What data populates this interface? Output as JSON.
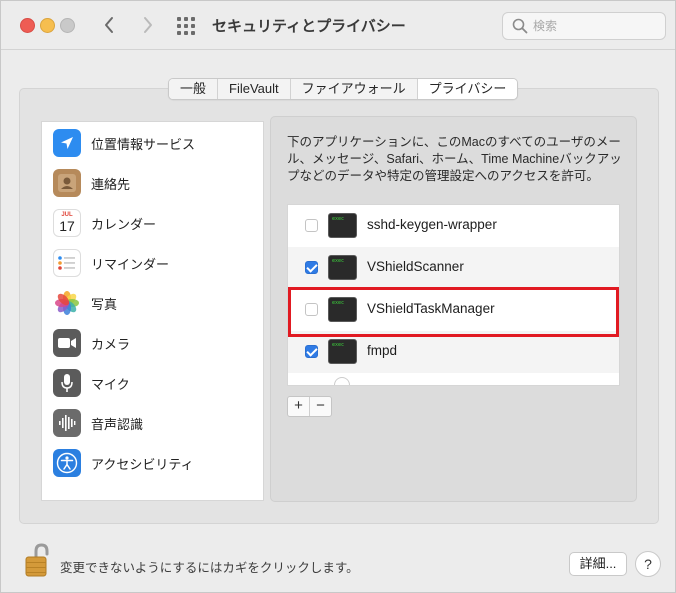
{
  "window": {
    "title": "セキュリティとプライバシー",
    "search_placeholder": "検索"
  },
  "tabs": [
    {
      "label": "一般",
      "active": false
    },
    {
      "label": "FileVault",
      "active": false
    },
    {
      "label": "ファイアウォール",
      "active": false
    },
    {
      "label": "プライバシー",
      "active": true
    }
  ],
  "sidebar": {
    "items": [
      {
        "label": "位置情報サービス",
        "icon": "location-arrow-icon"
      },
      {
        "label": "連絡先",
        "icon": "contacts-icon"
      },
      {
        "label": "カレンダー",
        "icon": "calendar-icon",
        "calendar_month": "JUL",
        "calendar_day": "17"
      },
      {
        "label": "リマインダー",
        "icon": "reminders-icon"
      },
      {
        "label": "写真",
        "icon": "photos-icon"
      },
      {
        "label": "カメラ",
        "icon": "camera-icon"
      },
      {
        "label": "マイク",
        "icon": "microphone-icon"
      },
      {
        "label": "音声認識",
        "icon": "speech-recognition-icon"
      },
      {
        "label": "アクセシビリティ",
        "icon": "accessibility-icon"
      }
    ]
  },
  "main": {
    "description": "下のアプリケーションに、このMacのすべてのユーザのメール、メッセージ、Safari、ホーム、Time Machineバックアップなどのデータや特定の管理設定へのアクセスを許可。",
    "apps": [
      {
        "name": "sshd-keygen-wrapper",
        "checked": false
      },
      {
        "name": "VShieldScanner",
        "checked": true
      },
      {
        "name": "VShieldTaskManager",
        "checked": false,
        "highlighted": true
      },
      {
        "name": "fmpd",
        "checked": true
      }
    ],
    "add_label": "+",
    "remove_label": "−"
  },
  "footer": {
    "lock_text": "変更できないようにするにはカギをクリックします。",
    "details_label": "詳細...",
    "help_label": "?"
  },
  "colors": {
    "accent": "#2f7be5",
    "highlight": "#e11a22"
  }
}
